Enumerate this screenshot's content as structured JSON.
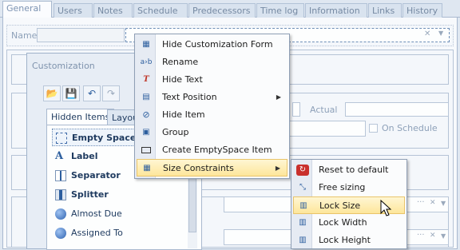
{
  "tabs": [
    "General",
    "Users",
    "Notes",
    "Schedule",
    "Predecessors",
    "Time log",
    "Information",
    "Links",
    "History"
  ],
  "name_label": "Name",
  "customization": {
    "title": "Customization",
    "tabs": [
      "Hidden Items",
      "Layou"
    ],
    "hidden_items": [
      "Empty Space",
      "Label",
      "Separator",
      "Splitter",
      "Almost Due",
      "Assigned To"
    ]
  },
  "background_labels": {
    "actual": "Actual",
    "on_schedule": "On Schedule"
  },
  "context_menu": {
    "items": [
      "Hide Customization Form",
      "Rename",
      "Hide Text",
      "Text Position",
      "Hide Item",
      "Group",
      "Create EmptySpace Item",
      "Size Constraints"
    ],
    "icons": [
      "customize-icon",
      "rename-icon",
      "hide-text-icon",
      "text-position-icon",
      "hide-item-icon",
      "group-icon",
      "empty-space-icon",
      "size-constraints-icon"
    ],
    "highlighted": "Size Constraints"
  },
  "submenu": {
    "items": [
      "Reset to default",
      "Free sizing",
      "Lock Size",
      "Lock Width",
      "Lock Height"
    ],
    "highlighted": "Lock Size"
  },
  "colors": {
    "highlight": "#fde69b",
    "border": "#a9b9cf",
    "accent": "#1e3a5f"
  }
}
